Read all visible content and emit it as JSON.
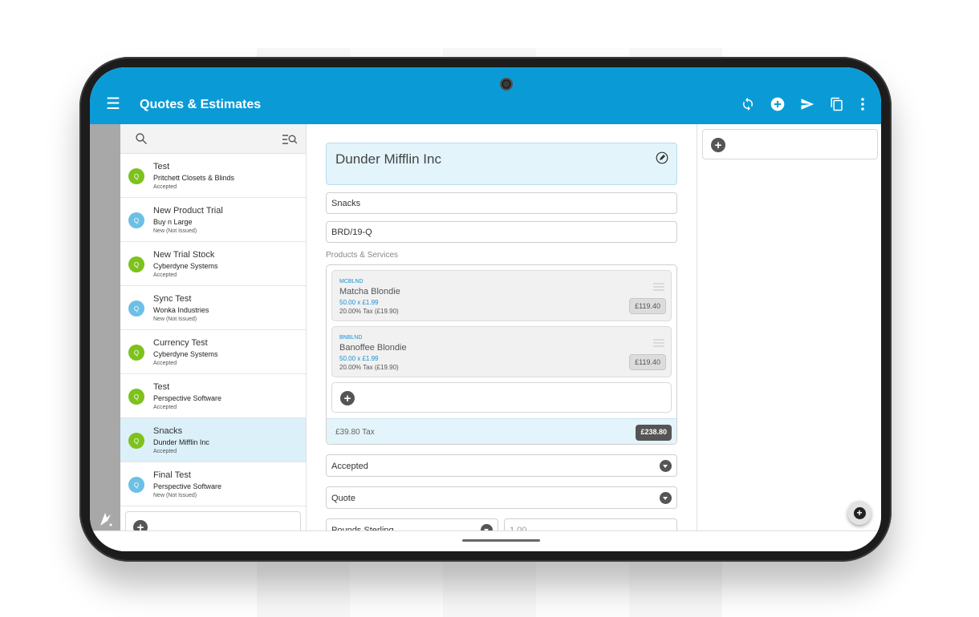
{
  "app": {
    "title": "Quotes & Estimates",
    "accent_color": "#0a9bd6",
    "actions": [
      {
        "name": "sync-icon",
        "glyph": "⟳"
      },
      {
        "name": "add-circle-icon",
        "glyph": "+"
      },
      {
        "name": "send-icon",
        "glyph": "➤"
      },
      {
        "name": "copy-icon",
        "glyph": "⧉"
      },
      {
        "name": "more-vert-icon",
        "glyph": "⋮"
      }
    ]
  },
  "quotes": [
    {
      "title": "Test",
      "customer": "Pritchett Closets & Blinds",
      "status": "Accepted",
      "avatar": "Q",
      "color": "#7dc21b",
      "selected": false
    },
    {
      "title": "New Product Trial",
      "customer": "Buy n Large",
      "status": "New (Not Issued)",
      "avatar": "Q",
      "color": "#6cc0e5",
      "selected": false
    },
    {
      "title": "New Trial Stock",
      "customer": "Cyberdyne Systems",
      "status": "Accepted",
      "avatar": "Q",
      "color": "#7dc21b",
      "selected": false
    },
    {
      "title": "Sync Test",
      "customer": "Wonka Industries",
      "status": "New (Not Issued)",
      "avatar": "Q",
      "color": "#6cc0e5",
      "selected": false
    },
    {
      "title": "Currency Test",
      "customer": "Cyberdyne Systems",
      "status": "Accepted",
      "avatar": "Q",
      "color": "#7dc21b",
      "selected": false
    },
    {
      "title": "Test",
      "customer": "Perspective Software",
      "status": "Accepted",
      "avatar": "Q",
      "color": "#7dc21b",
      "selected": false
    },
    {
      "title": "Snacks",
      "customer": "Dunder Mifflin Inc",
      "status": "Accepted",
      "avatar": "Q",
      "color": "#7dc21b",
      "selected": true
    },
    {
      "title": "Final Test",
      "customer": "Perspective Software",
      "status": "New (Not Issued)",
      "avatar": "Q",
      "color": "#6cc0e5",
      "selected": false
    }
  ],
  "detail": {
    "customer": "Dunder Mifflin Inc",
    "title": "Snacks",
    "reference": "BRD/19-Q",
    "products_label": "Products & Services",
    "products": [
      {
        "code": "MCBLND",
        "name": "Matcha Blondie",
        "qty": "50.00 x £1.99",
        "tax": "20.00% Tax (£19.90)",
        "amount": "£119.40"
      },
      {
        "code": "BNBLND",
        "name": "Banoffee Blondie",
        "qty": "50.00 x £1.99",
        "tax": "20.00% Tax (£19.90)",
        "amount": "£119.40"
      }
    ],
    "tax_total": "£39.80 Tax",
    "grand_total": "£238.80",
    "status": "Accepted",
    "type": "Quote",
    "currency": "Pounds Sterling",
    "exchange_rate": "1.00"
  }
}
